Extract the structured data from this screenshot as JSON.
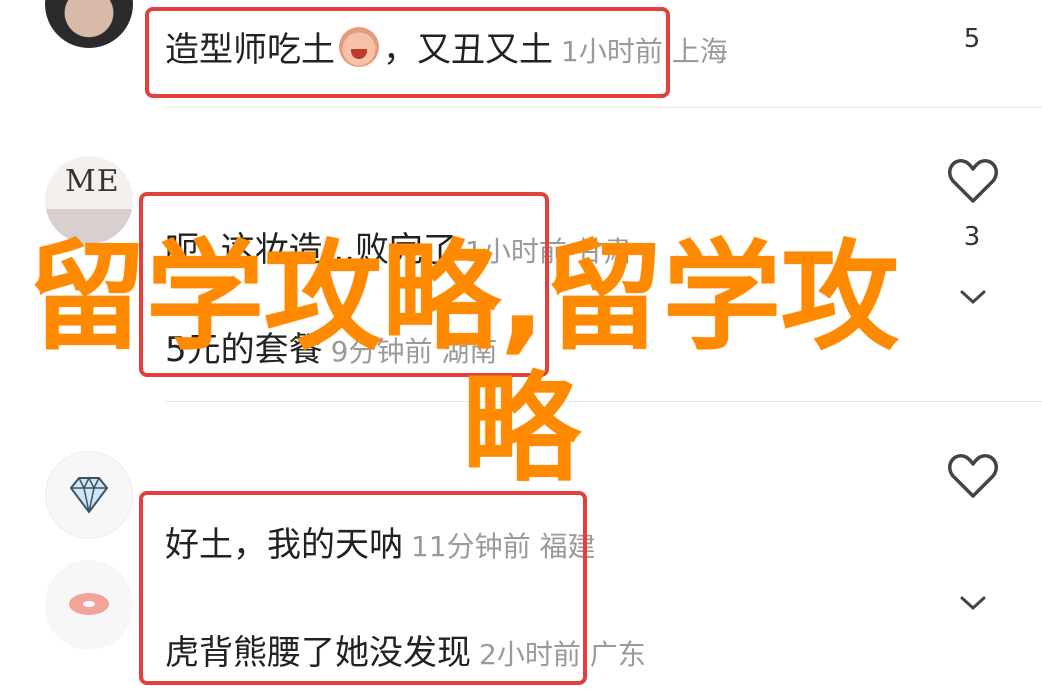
{
  "comments": [
    {
      "text_a": "造型师吃土",
      "emoji": "crying-face-emoji",
      "text_b": "，又丑又土",
      "meta": "1小时前 上海",
      "likes": "5"
    },
    {
      "text": "呃..这妆造...败完了",
      "meta": "1小时前 甘肃",
      "likes": "3"
    },
    {
      "text": "5元的套餐",
      "meta": "9分钟前 湖南"
    },
    {
      "text": "好土，我的天呐",
      "meta": "11分钟前 福建"
    },
    {
      "text": "虎背熊腰了她没发现",
      "meta": "2小时前 广东"
    }
  ],
  "avatars": {
    "me_text": "ME"
  },
  "overlay": {
    "line1": "留学攻略,留学攻",
    "line2": "略"
  },
  "colors": {
    "highlight_box": "#e2413b",
    "overlay_text": "#ff8a00",
    "meta_text": "#9a9a9a"
  },
  "icons": [
    "heart-outline-icon",
    "chevron-down-icon"
  ]
}
